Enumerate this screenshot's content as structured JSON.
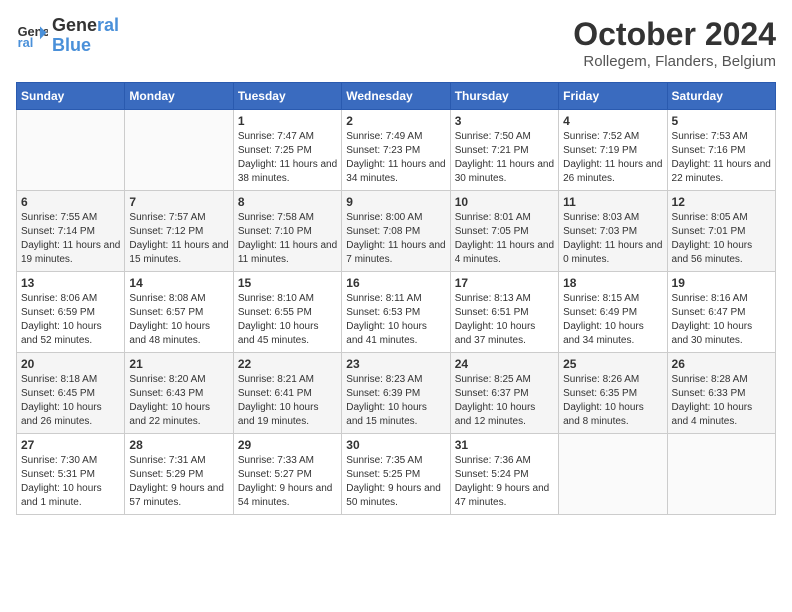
{
  "header": {
    "logo_line1": "General",
    "logo_line2": "Blue",
    "month": "October 2024",
    "location": "Rollegem, Flanders, Belgium"
  },
  "weekdays": [
    "Sunday",
    "Monday",
    "Tuesday",
    "Wednesday",
    "Thursday",
    "Friday",
    "Saturday"
  ],
  "weeks": [
    [
      {
        "day": "",
        "info": ""
      },
      {
        "day": "",
        "info": ""
      },
      {
        "day": "1",
        "info": "Sunrise: 7:47 AM\nSunset: 7:25 PM\nDaylight: 11 hours and 38 minutes."
      },
      {
        "day": "2",
        "info": "Sunrise: 7:49 AM\nSunset: 7:23 PM\nDaylight: 11 hours and 34 minutes."
      },
      {
        "day": "3",
        "info": "Sunrise: 7:50 AM\nSunset: 7:21 PM\nDaylight: 11 hours and 30 minutes."
      },
      {
        "day": "4",
        "info": "Sunrise: 7:52 AM\nSunset: 7:19 PM\nDaylight: 11 hours and 26 minutes."
      },
      {
        "day": "5",
        "info": "Sunrise: 7:53 AM\nSunset: 7:16 PM\nDaylight: 11 hours and 22 minutes."
      }
    ],
    [
      {
        "day": "6",
        "info": "Sunrise: 7:55 AM\nSunset: 7:14 PM\nDaylight: 11 hours and 19 minutes."
      },
      {
        "day": "7",
        "info": "Sunrise: 7:57 AM\nSunset: 7:12 PM\nDaylight: 11 hours and 15 minutes."
      },
      {
        "day": "8",
        "info": "Sunrise: 7:58 AM\nSunset: 7:10 PM\nDaylight: 11 hours and 11 minutes."
      },
      {
        "day": "9",
        "info": "Sunrise: 8:00 AM\nSunset: 7:08 PM\nDaylight: 11 hours and 7 minutes."
      },
      {
        "day": "10",
        "info": "Sunrise: 8:01 AM\nSunset: 7:05 PM\nDaylight: 11 hours and 4 minutes."
      },
      {
        "day": "11",
        "info": "Sunrise: 8:03 AM\nSunset: 7:03 PM\nDaylight: 11 hours and 0 minutes."
      },
      {
        "day": "12",
        "info": "Sunrise: 8:05 AM\nSunset: 7:01 PM\nDaylight: 10 hours and 56 minutes."
      }
    ],
    [
      {
        "day": "13",
        "info": "Sunrise: 8:06 AM\nSunset: 6:59 PM\nDaylight: 10 hours and 52 minutes."
      },
      {
        "day": "14",
        "info": "Sunrise: 8:08 AM\nSunset: 6:57 PM\nDaylight: 10 hours and 48 minutes."
      },
      {
        "day": "15",
        "info": "Sunrise: 8:10 AM\nSunset: 6:55 PM\nDaylight: 10 hours and 45 minutes."
      },
      {
        "day": "16",
        "info": "Sunrise: 8:11 AM\nSunset: 6:53 PM\nDaylight: 10 hours and 41 minutes."
      },
      {
        "day": "17",
        "info": "Sunrise: 8:13 AM\nSunset: 6:51 PM\nDaylight: 10 hours and 37 minutes."
      },
      {
        "day": "18",
        "info": "Sunrise: 8:15 AM\nSunset: 6:49 PM\nDaylight: 10 hours and 34 minutes."
      },
      {
        "day": "19",
        "info": "Sunrise: 8:16 AM\nSunset: 6:47 PM\nDaylight: 10 hours and 30 minutes."
      }
    ],
    [
      {
        "day": "20",
        "info": "Sunrise: 8:18 AM\nSunset: 6:45 PM\nDaylight: 10 hours and 26 minutes."
      },
      {
        "day": "21",
        "info": "Sunrise: 8:20 AM\nSunset: 6:43 PM\nDaylight: 10 hours and 22 minutes."
      },
      {
        "day": "22",
        "info": "Sunrise: 8:21 AM\nSunset: 6:41 PM\nDaylight: 10 hours and 19 minutes."
      },
      {
        "day": "23",
        "info": "Sunrise: 8:23 AM\nSunset: 6:39 PM\nDaylight: 10 hours and 15 minutes."
      },
      {
        "day": "24",
        "info": "Sunrise: 8:25 AM\nSunset: 6:37 PM\nDaylight: 10 hours and 12 minutes."
      },
      {
        "day": "25",
        "info": "Sunrise: 8:26 AM\nSunset: 6:35 PM\nDaylight: 10 hours and 8 minutes."
      },
      {
        "day": "26",
        "info": "Sunrise: 8:28 AM\nSunset: 6:33 PM\nDaylight: 10 hours and 4 minutes."
      }
    ],
    [
      {
        "day": "27",
        "info": "Sunrise: 7:30 AM\nSunset: 5:31 PM\nDaylight: 10 hours and 1 minute."
      },
      {
        "day": "28",
        "info": "Sunrise: 7:31 AM\nSunset: 5:29 PM\nDaylight: 9 hours and 57 minutes."
      },
      {
        "day": "29",
        "info": "Sunrise: 7:33 AM\nSunset: 5:27 PM\nDaylight: 9 hours and 54 minutes."
      },
      {
        "day": "30",
        "info": "Sunrise: 7:35 AM\nSunset: 5:25 PM\nDaylight: 9 hours and 50 minutes."
      },
      {
        "day": "31",
        "info": "Sunrise: 7:36 AM\nSunset: 5:24 PM\nDaylight: 9 hours and 47 minutes."
      },
      {
        "day": "",
        "info": ""
      },
      {
        "day": "",
        "info": ""
      }
    ]
  ]
}
